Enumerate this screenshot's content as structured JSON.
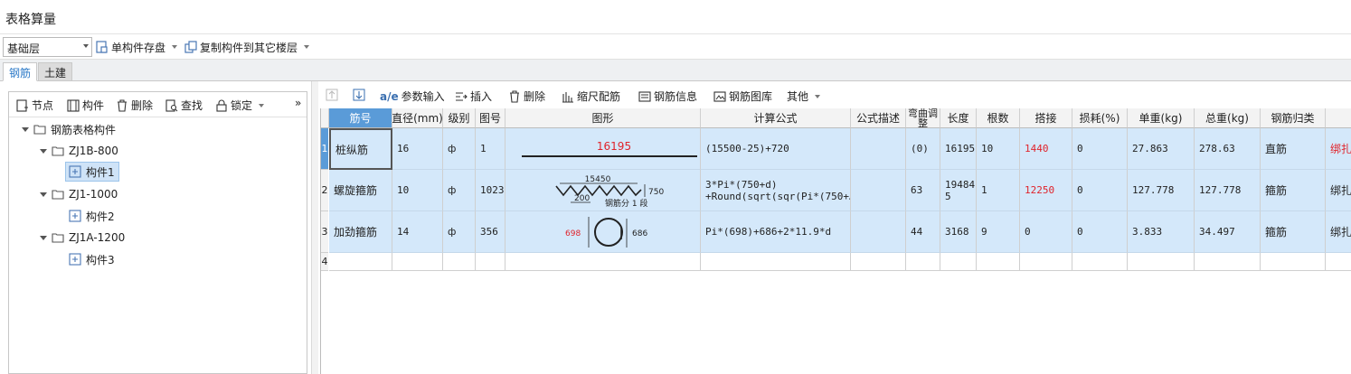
{
  "app": {
    "title": "表格算量"
  },
  "toolbar": {
    "floor_value": "基础层",
    "save_label": "单构件存盘",
    "copy_label": "复制构件到其它楼层"
  },
  "tabs": [
    {
      "label": "钢筋",
      "active": true
    },
    {
      "label": "土建",
      "active": false
    }
  ],
  "left_toolbar": {
    "node": "节点",
    "component": "构件",
    "delete": "删除",
    "find": "查找",
    "lock": "锁定",
    "more": "»"
  },
  "tree": {
    "root": "钢筋表格构件",
    "groups": [
      {
        "label": "ZJ1B-800",
        "child": "构件1",
        "selected": true
      },
      {
        "label": "ZJ1-1000",
        "child": "构件2",
        "selected": false
      },
      {
        "label": "ZJ1A-1200",
        "child": "构件3",
        "selected": false
      }
    ]
  },
  "right_toolbar": {
    "param_input": "参数输入",
    "insert": "插入",
    "delete": "删除",
    "scale": "缩尺配筋",
    "info": "钢筋信息",
    "library": "钢筋图库",
    "other": "其他"
  },
  "grid": {
    "headers": [
      "筋号",
      "直径(mm)",
      "级别",
      "图号",
      "图形",
      "计算公式",
      "公式描述",
      "弯曲调整",
      "长度",
      "根数",
      "搭接",
      "损耗(%)",
      "单重(kg)",
      "总重(kg)",
      "钢筋归类",
      ""
    ],
    "rows": [
      {
        "num": "1",
        "name": "桩纵筋",
        "dia": "16",
        "grade": "ф",
        "fig": "1",
        "shape": {
          "type": "straight",
          "label": "16195"
        },
        "formula1": "(15500-25)+720",
        "formula2": "",
        "desc": "",
        "bend": "(0)",
        "length": "16195",
        "count": "10",
        "lap": "1440",
        "loss": "0",
        "unit": "27.863",
        "total": "278.63",
        "cat": "直筋",
        "tie": "绑扎"
      },
      {
        "num": "2",
        "name": "螺旋箍筋",
        "dia": "10",
        "grade": "ф",
        "fig": "1023",
        "shape": {
          "type": "spiral",
          "top": "15450",
          "left": "200",
          "right": "750",
          "note": "钢筋分 1 段"
        },
        "formula1": "3*Pi*(750+d)",
        "formula2": "+Round(sqrt(sqr(Pi*(750+…",
        "desc": "",
        "bend": "63",
        "length": "19484",
        "length2": "5",
        "count": "1",
        "lap": "12250",
        "loss": "0",
        "unit": "127.778",
        "total": "127.778",
        "cat": "箍筋",
        "tie": "绑扎"
      },
      {
        "num": "3",
        "name": "加劲箍筋",
        "dia": "14",
        "grade": "ф",
        "fig": "356",
        "shape": {
          "type": "ring",
          "left": "698",
          "right": "686"
        },
        "formula1": "Pi*(698)+686+2*11.9*d",
        "formula2": "",
        "desc": "",
        "bend": "44",
        "length": "3168",
        "count": "9",
        "lap": "0",
        "loss": "0",
        "unit": "3.833",
        "total": "34.497",
        "cat": "箍筋",
        "tie": "绑扎"
      },
      {
        "num": "4",
        "name": "",
        "dia": "",
        "grade": "",
        "fig": "",
        "formula1": "",
        "formula2": "",
        "desc": "",
        "bend": "",
        "length": "",
        "count": "",
        "lap": "",
        "loss": "",
        "unit": "",
        "total": "",
        "cat": "",
        "tie": ""
      }
    ]
  },
  "colors": {
    "accent": "#5a9bd8",
    "selected_row": "#d4e8fa",
    "red_text": "#e0232b"
  }
}
